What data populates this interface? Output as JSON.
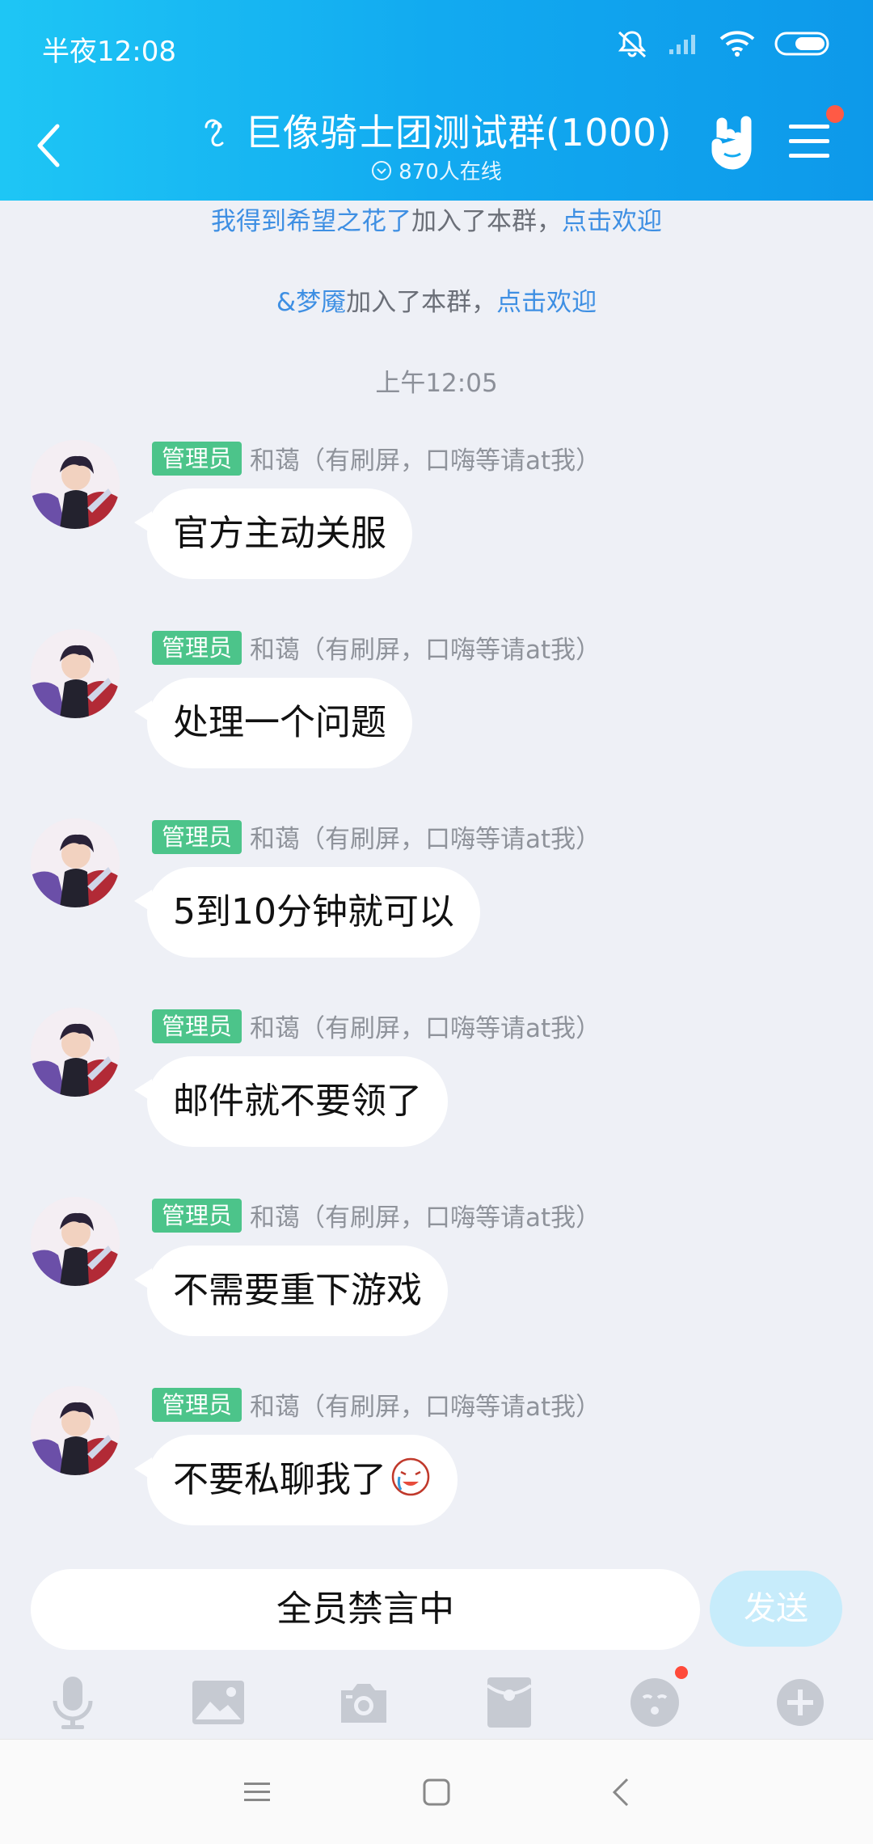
{
  "status_bar": {
    "time": "半夜12:08"
  },
  "header": {
    "group_title": "巨像骑士团测试群(1000)",
    "online_text": "870人在线"
  },
  "notices": [
    {
      "name": "我得到希望之花了",
      "text": "加入了本群，",
      "link": "点击欢迎"
    },
    {
      "name": "&梦魇",
      "text": "加入了本群，",
      "link": "点击欢迎"
    }
  ],
  "time_divider": "上午12:05",
  "messages": [
    {
      "role": "管理员",
      "sender": "和蔼（有刷屏，口嗨等请at我）",
      "text": "官方主动关服"
    },
    {
      "role": "管理员",
      "sender": "和蔼（有刷屏，口嗨等请at我）",
      "text": "处理一个问题"
    },
    {
      "role": "管理员",
      "sender": "和蔼（有刷屏，口嗨等请at我）",
      "text": "5到10分钟就可以"
    },
    {
      "role": "管理员",
      "sender": "和蔼（有刷屏，口嗨等请at我）",
      "text": "邮件就不要领了"
    },
    {
      "role": "管理员",
      "sender": "和蔼（有刷屏，口嗨等请at我）",
      "text": "不需要重下游戏"
    },
    {
      "role": "管理员",
      "sender": "和蔼（有刷屏，口嗨等请at我）",
      "text": "不要私聊我了"
    }
  ],
  "input": {
    "muted_text": "全员禁言中",
    "send_label": "发送"
  },
  "colors": {
    "header_start": "#1ec6f5",
    "header_end": "#0d99ea",
    "admin_badge": "#4cc48a",
    "link": "#3e8fe3",
    "notification_dot": "#ff5a45"
  },
  "icons": {
    "toolbar": [
      "microphone-icon",
      "image-icon",
      "camera-icon",
      "red-packet-icon",
      "emoji-icon",
      "plus-icon"
    ],
    "navbar": [
      "menu-icon",
      "home-icon",
      "back-icon"
    ]
  }
}
